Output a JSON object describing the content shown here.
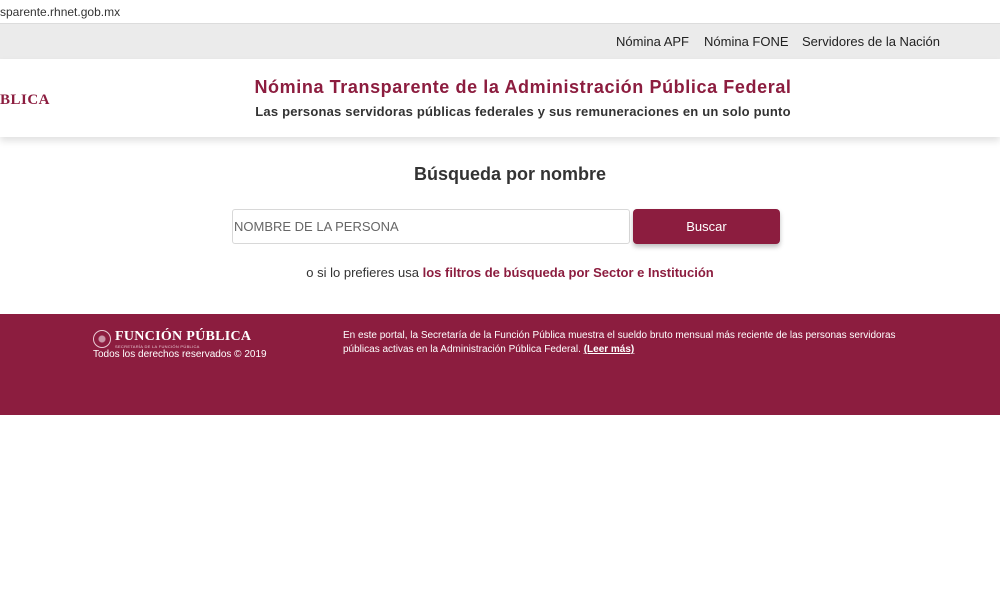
{
  "browser": {
    "url": "sparente.rhnet.gob.mx"
  },
  "nav": {
    "items": [
      "Nómina APF",
      "Nómina FONE",
      "Servidores de la Nación"
    ]
  },
  "header": {
    "logo_text": "BLICA",
    "title": "Nómina Transparente de la Administración Pública Federal",
    "subtitle": "Las personas servidoras públicas federales y sus remuneraciones en un solo punto"
  },
  "search": {
    "title": "Búsqueda por nombre",
    "placeholder": "NOMBRE DE LA PERSONA",
    "value": "",
    "button_label": "Buscar",
    "alt_prefix": "o si lo prefieres usa",
    "alt_link": "los filtros de búsqueda por Sector e Institución"
  },
  "footer": {
    "brand": "FUNCIÓN PÚBLICA",
    "brand_tag": "SECRETARÍA DE LA FUNCIÓN PÚBLICA",
    "rights": "Todos los derechos reservados © 2019",
    "info_text": "En este portal, la Secretaría de la Función Pública muestra el sueldo bruto mensual más reciente de las personas servidoras públicas activas en la Administración Pública Federal.",
    "more_link": "(Leer más)"
  },
  "colors": {
    "brand": "#8c1d3f",
    "nav_bg": "#ebebeb"
  }
}
